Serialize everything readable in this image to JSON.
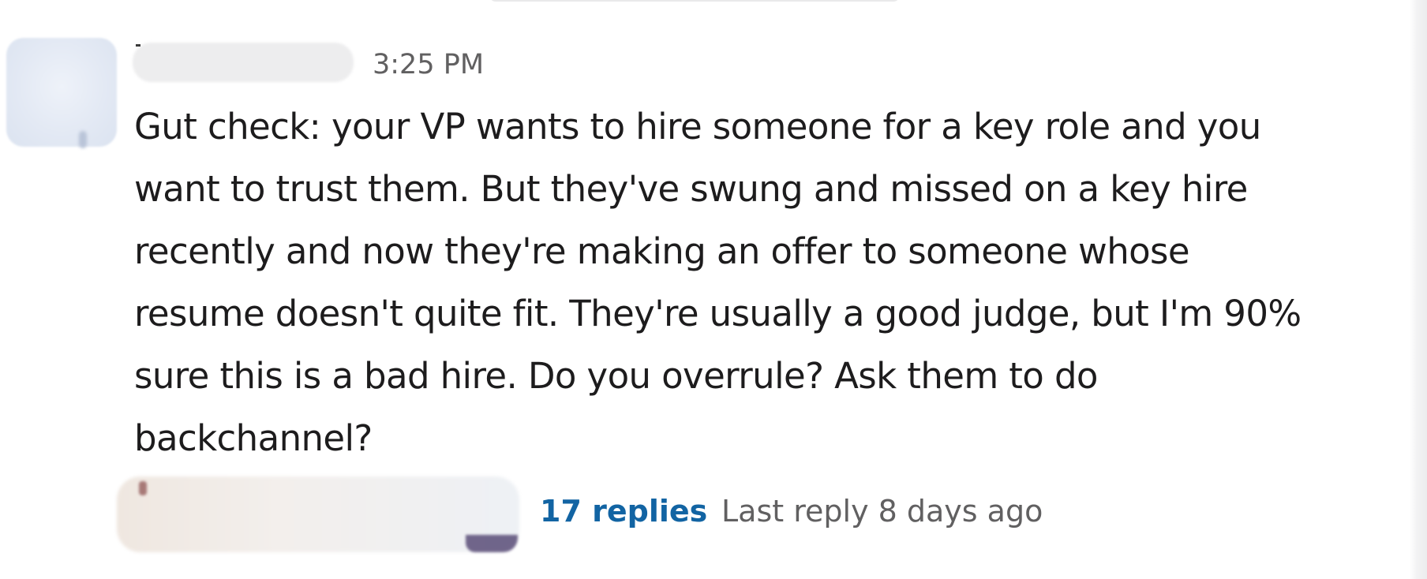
{
  "message": {
    "timestamp": "3:25 PM",
    "body_lines": [
      "Gut check: your VP wants to hire someone for a key role and you",
      "want to trust them. But they've swung and missed on a key hire",
      "recently and now they're making an offer to someone whose",
      "resume doesn't quite fit. They're usually a good judge, but I'm 90%",
      "sure this is a bad hire. Do you overrule? Ask them to do",
      "backchannel?"
    ]
  },
  "thread": {
    "reply_count_label": "17 replies",
    "last_reply_label": "Last reply 8 days ago"
  },
  "colors": {
    "link": "#1264a3",
    "text": "#1d1c1d",
    "muted": "#616061",
    "background": "#ffffff"
  }
}
